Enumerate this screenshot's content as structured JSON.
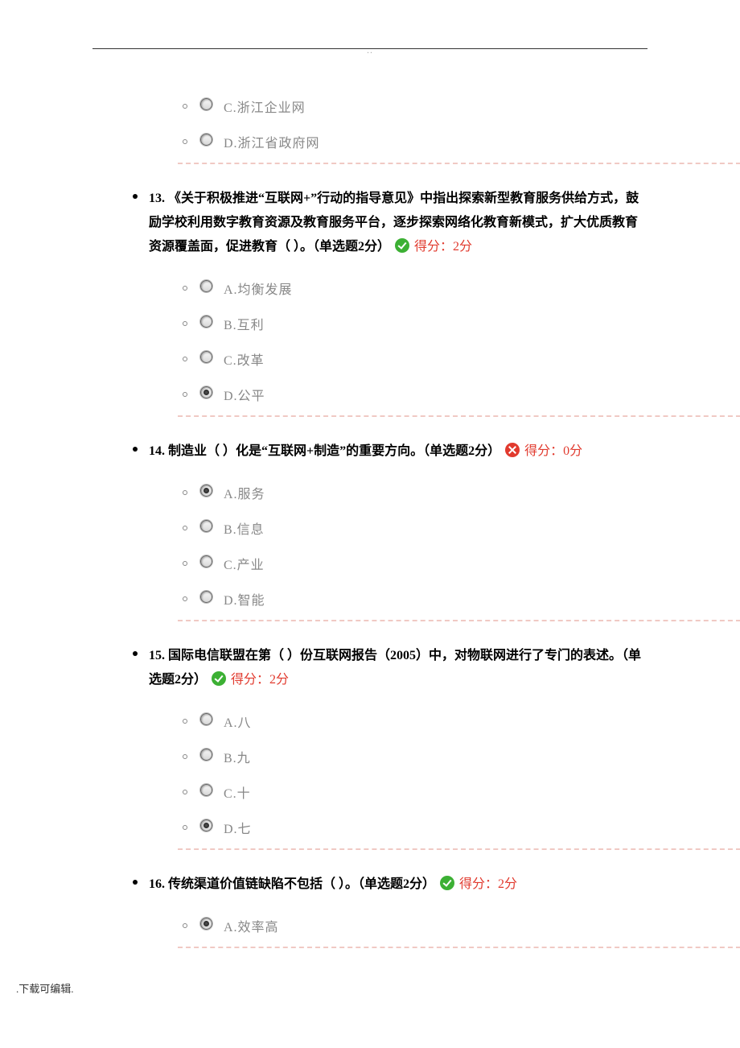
{
  "header_dots": "..",
  "footer": ".下载可编辑.",
  "q12_tail": {
    "options": [
      {
        "sel": false,
        "label": "C.浙江企业网"
      },
      {
        "sel": false,
        "label": "D.浙江省政府网"
      }
    ]
  },
  "questions": [
    {
      "num": "13.",
      "stem": "《关于积极推进“互联网+”行动的指导意见》中指出探索新型教育服务供给方式，鼓励学校利用数字教育资源及教育服务平台，逐步探索网络化教育新模式，扩大优质教育资源覆盖面，促进教育（ ）。（单选题2分）",
      "result": "correct",
      "score": "得分：2分",
      "options": [
        {
          "sel": false,
          "label": "A.均衡发展"
        },
        {
          "sel": false,
          "label": "B.互利"
        },
        {
          "sel": false,
          "label": "C.改革"
        },
        {
          "sel": true,
          "label": "D.公平"
        }
      ]
    },
    {
      "num": "14.",
      "stem": "制造业（ ）化是“互联网+制造”的重要方向。（单选题2分）",
      "result": "wrong",
      "score": "得分：0分",
      "options": [
        {
          "sel": true,
          "label": "A.服务"
        },
        {
          "sel": false,
          "label": "B.信息"
        },
        {
          "sel": false,
          "label": "C.产业"
        },
        {
          "sel": false,
          "label": "D.智能"
        }
      ]
    },
    {
      "num": "15.",
      "stem": "国际电信联盟在第（ ）份互联网报告（2005）中，对物联网进行了专门的表述。（单选题2分）",
      "result": "correct",
      "score": "得分：2分",
      "options": [
        {
          "sel": false,
          "label": "A.八"
        },
        {
          "sel": false,
          "label": "B.九"
        },
        {
          "sel": false,
          "label": "C.十"
        },
        {
          "sel": true,
          "label": "D.七"
        }
      ]
    },
    {
      "num": "16.",
      "stem": "传统渠道价值链缺陷不包括（ ）。（单选题2分）",
      "result": "correct",
      "score": "得分：2分",
      "options": [
        {
          "sel": true,
          "label": "A.效率高"
        }
      ]
    }
  ]
}
